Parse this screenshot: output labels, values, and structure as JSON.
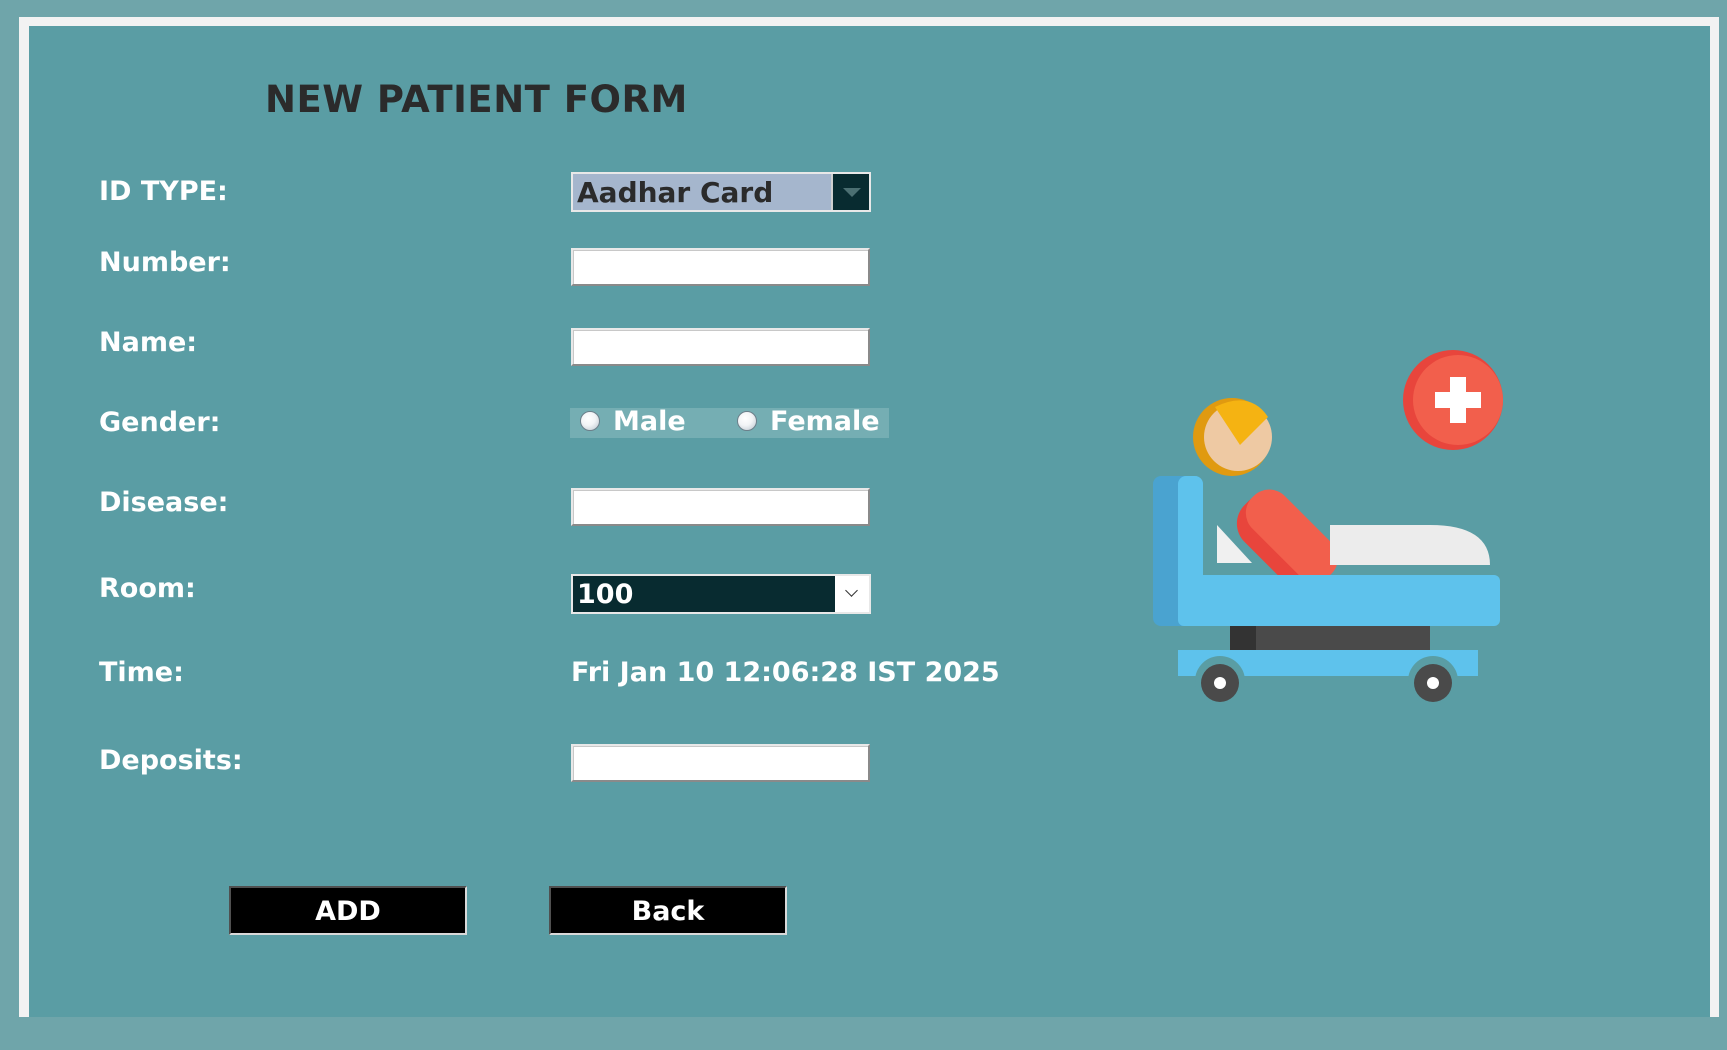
{
  "form": {
    "title": "NEW PATIENT FORM",
    "labels": {
      "id_type": "ID TYPE:",
      "number": "Number:",
      "name": "Name:",
      "gender": "Gender:",
      "disease": "Disease:",
      "room": "Room:",
      "time": "Time:",
      "deposits": "Deposits:"
    },
    "id_type_selected": "Aadhar Card",
    "number_value": "",
    "name_value": "",
    "gender_options": {
      "male": "Male",
      "female": "Female"
    },
    "disease_value": "",
    "room_selected": "100",
    "time_value": "Fri Jan 10 12:06:28 IST 2025",
    "deposits_value": ""
  },
  "buttons": {
    "add": "ADD",
    "back": "Back"
  },
  "illustration": {
    "icon": "hospital-bed-patient-icon"
  },
  "colors": {
    "background": "#5a9da4",
    "frame": "#f2f2f2",
    "button": "#000000",
    "id_type_bg": "#a5b6cd",
    "room_bg": "#082b30"
  }
}
